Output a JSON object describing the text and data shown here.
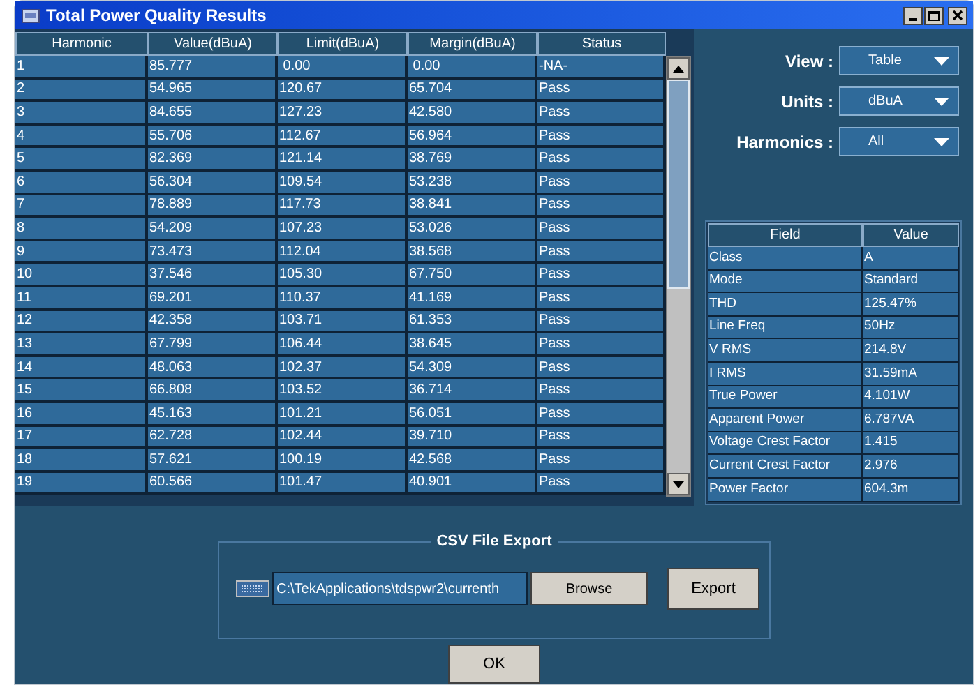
{
  "window": {
    "title": "Total Power Quality Results"
  },
  "table": {
    "columns": [
      "Harmonic",
      "Value(dBuA)",
      "Limit(dBuA)",
      "Margin(dBuA)",
      "Status"
    ],
    "rows": [
      [
        "1",
        "85.777",
        " 0.00",
        " 0.00",
        "-NA-"
      ],
      [
        "2",
        "54.965",
        "120.67",
        "65.704",
        "Pass"
      ],
      [
        "3",
        "84.655",
        "127.23",
        "42.580",
        "Pass"
      ],
      [
        "4",
        "55.706",
        "112.67",
        "56.964",
        "Pass"
      ],
      [
        "5",
        "82.369",
        "121.14",
        "38.769",
        "Pass"
      ],
      [
        "6",
        "56.304",
        "109.54",
        "53.238",
        "Pass"
      ],
      [
        "7",
        "78.889",
        "117.73",
        "38.841",
        "Pass"
      ],
      [
        "8",
        "54.209",
        "107.23",
        "53.026",
        "Pass"
      ],
      [
        "9",
        "73.473",
        "112.04",
        "38.568",
        "Pass"
      ],
      [
        "10",
        "37.546",
        "105.30",
        "67.750",
        "Pass"
      ],
      [
        "11",
        "69.201",
        "110.37",
        "41.169",
        "Pass"
      ],
      [
        "12",
        "42.358",
        "103.71",
        "61.353",
        "Pass"
      ],
      [
        "13",
        "67.799",
        "106.44",
        "38.645",
        "Pass"
      ],
      [
        "14",
        "48.063",
        "102.37",
        "54.309",
        "Pass"
      ],
      [
        "15",
        "66.808",
        "103.52",
        "36.714",
        "Pass"
      ],
      [
        "16",
        "45.163",
        "101.21",
        "56.051",
        "Pass"
      ],
      [
        "17",
        "62.728",
        "102.44",
        "39.710",
        "Pass"
      ],
      [
        "18",
        "57.621",
        "100.19",
        "42.568",
        "Pass"
      ],
      [
        "19",
        "60.566",
        "101.47",
        "40.901",
        "Pass"
      ]
    ]
  },
  "options": [
    {
      "label": "View :",
      "value": "Table"
    },
    {
      "label": "Units :",
      "value": "dBuA"
    },
    {
      "label": "Harmonics :",
      "value": "All"
    }
  ],
  "summary": {
    "columns": [
      "Field",
      "Value"
    ],
    "rows": [
      [
        "Class",
        "A"
      ],
      [
        "Mode",
        "Standard"
      ],
      [
        "THD",
        "125.47%"
      ],
      [
        "Line Freq",
        "50Hz"
      ],
      [
        "V RMS",
        "214.8V"
      ],
      [
        "I RMS",
        "31.59mA"
      ],
      [
        "True Power",
        "4.101W"
      ],
      [
        "Apparent Power",
        "6.787VA"
      ],
      [
        "Voltage Crest Factor",
        "1.415"
      ],
      [
        "Current Crest Factor",
        "2.976"
      ],
      [
        "Power Factor",
        "604.3m"
      ]
    ]
  },
  "csv_export": {
    "title": "CSV File Export",
    "path": "C:\\TekApplications\\tdspwr2\\currenth",
    "browse": "Browse",
    "export": "Export"
  },
  "ok": "OK"
}
